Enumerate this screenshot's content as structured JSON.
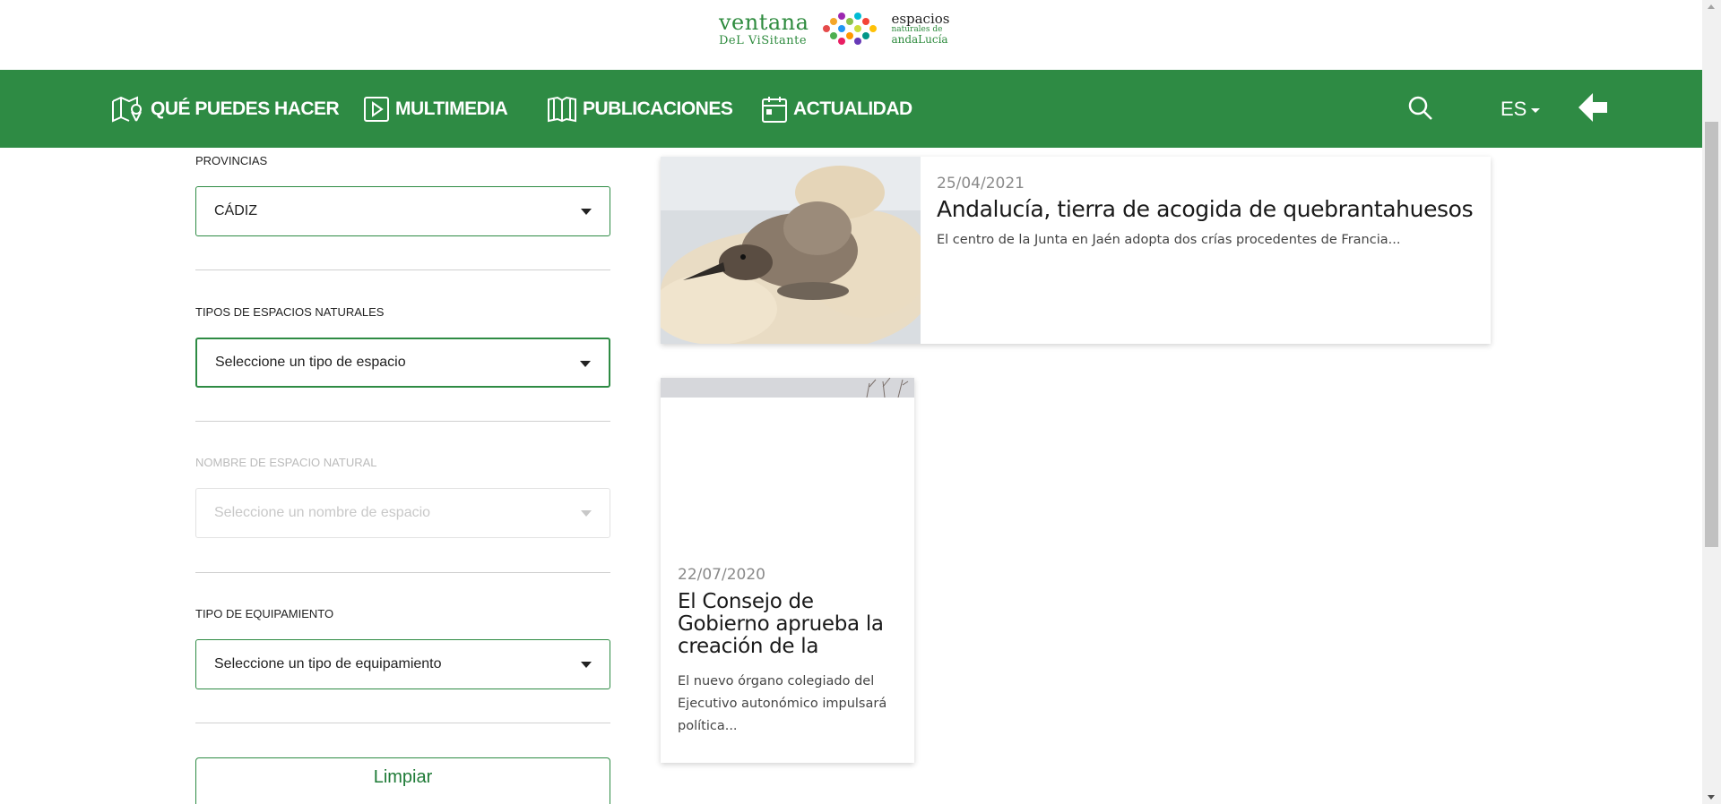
{
  "logo": {
    "line1": "ventana",
    "line2": "DeL ViSitante",
    "right1": "espacios",
    "right2": "naturales de",
    "right3": "andaLucía"
  },
  "nav": {
    "items": [
      {
        "label": "QUÉ PUEDES HACER",
        "icon": "map-pin-icon"
      },
      {
        "label": "MULTIMEDIA",
        "icon": "play-icon"
      },
      {
        "label": "PUBLICACIONES",
        "icon": "book-icon"
      },
      {
        "label": "ACTUALIDAD",
        "icon": "calendar-icon"
      }
    ],
    "language": "ES"
  },
  "filters": {
    "provincias": {
      "label": "PROVINCIAS",
      "value": "CÁDIZ"
    },
    "tipos": {
      "label": "TIPOS DE ESPACIOS NATURALES",
      "value": "Seleccione un tipo de espacio"
    },
    "nombre": {
      "label": "NOMBRE DE ESPACIO NATURAL",
      "value": "Seleccione un nombre de espacio"
    },
    "equipamiento": {
      "label": "TIPO DE EQUIPAMIENTO",
      "value": "Seleccione un tipo de equipamiento"
    },
    "clear_label": "Limpiar"
  },
  "news": [
    {
      "date": "25/04/2021",
      "title": "Andalucía, tierra de acogida de quebrantahuesos",
      "excerpt": "El centro de la Junta en Jaén adopta dos crías procedentes de Francia..."
    },
    {
      "date": "22/07/2020",
      "title": "El Consejo de Gobierno aprueba la creación de la",
      "excerpt": "El nuevo órgano colegiado del Ejecutivo autonómico impulsará política..."
    }
  ],
  "colors": {
    "brand_green": "#2e8b44",
    "button_text_green": "#1e7a36"
  }
}
